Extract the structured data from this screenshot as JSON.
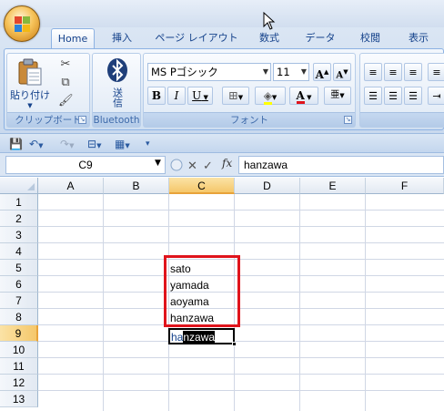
{
  "ribbon": {
    "tabs": [
      "Home",
      "挿入",
      "ページ レイアウト",
      "数式",
      "データ",
      "校閲",
      "表示"
    ],
    "active_tab": "Home",
    "clipboard": {
      "paste_label": "貼り付け",
      "group_label": "クリップボード"
    },
    "bluetooth": {
      "send_label": "送信",
      "group_label": "Bluetooth"
    },
    "font": {
      "font_name": "MS Pゴシック",
      "font_size": "11",
      "group_label": "フォント",
      "grow_label": "A",
      "shrink_label": "A",
      "bold": "B",
      "italic": "I",
      "underline": "U",
      "font_color_label": "A",
      "phonetic_label": "亜"
    }
  },
  "formula_bar": {
    "name_box": "C9",
    "fx_label": "fx",
    "formula": "hanzawa"
  },
  "sheet": {
    "columns": [
      "A",
      "B",
      "C",
      "D",
      "E",
      "F"
    ],
    "rows": [
      "1",
      "2",
      "3",
      "4",
      "5",
      "6",
      "7",
      "8",
      "9",
      "10",
      "11",
      "12",
      "13"
    ],
    "selected_column": "C",
    "selected_row": "9",
    "cells": {
      "C5": "sato",
      "C6": "yamada",
      "C7": "aoyama",
      "C8": "hanzawa"
    },
    "editing_cell": {
      "address": "C9",
      "typed_text": "ha",
      "autocomplete_text": "nzawa"
    },
    "highlight_color": "#e0141c"
  }
}
